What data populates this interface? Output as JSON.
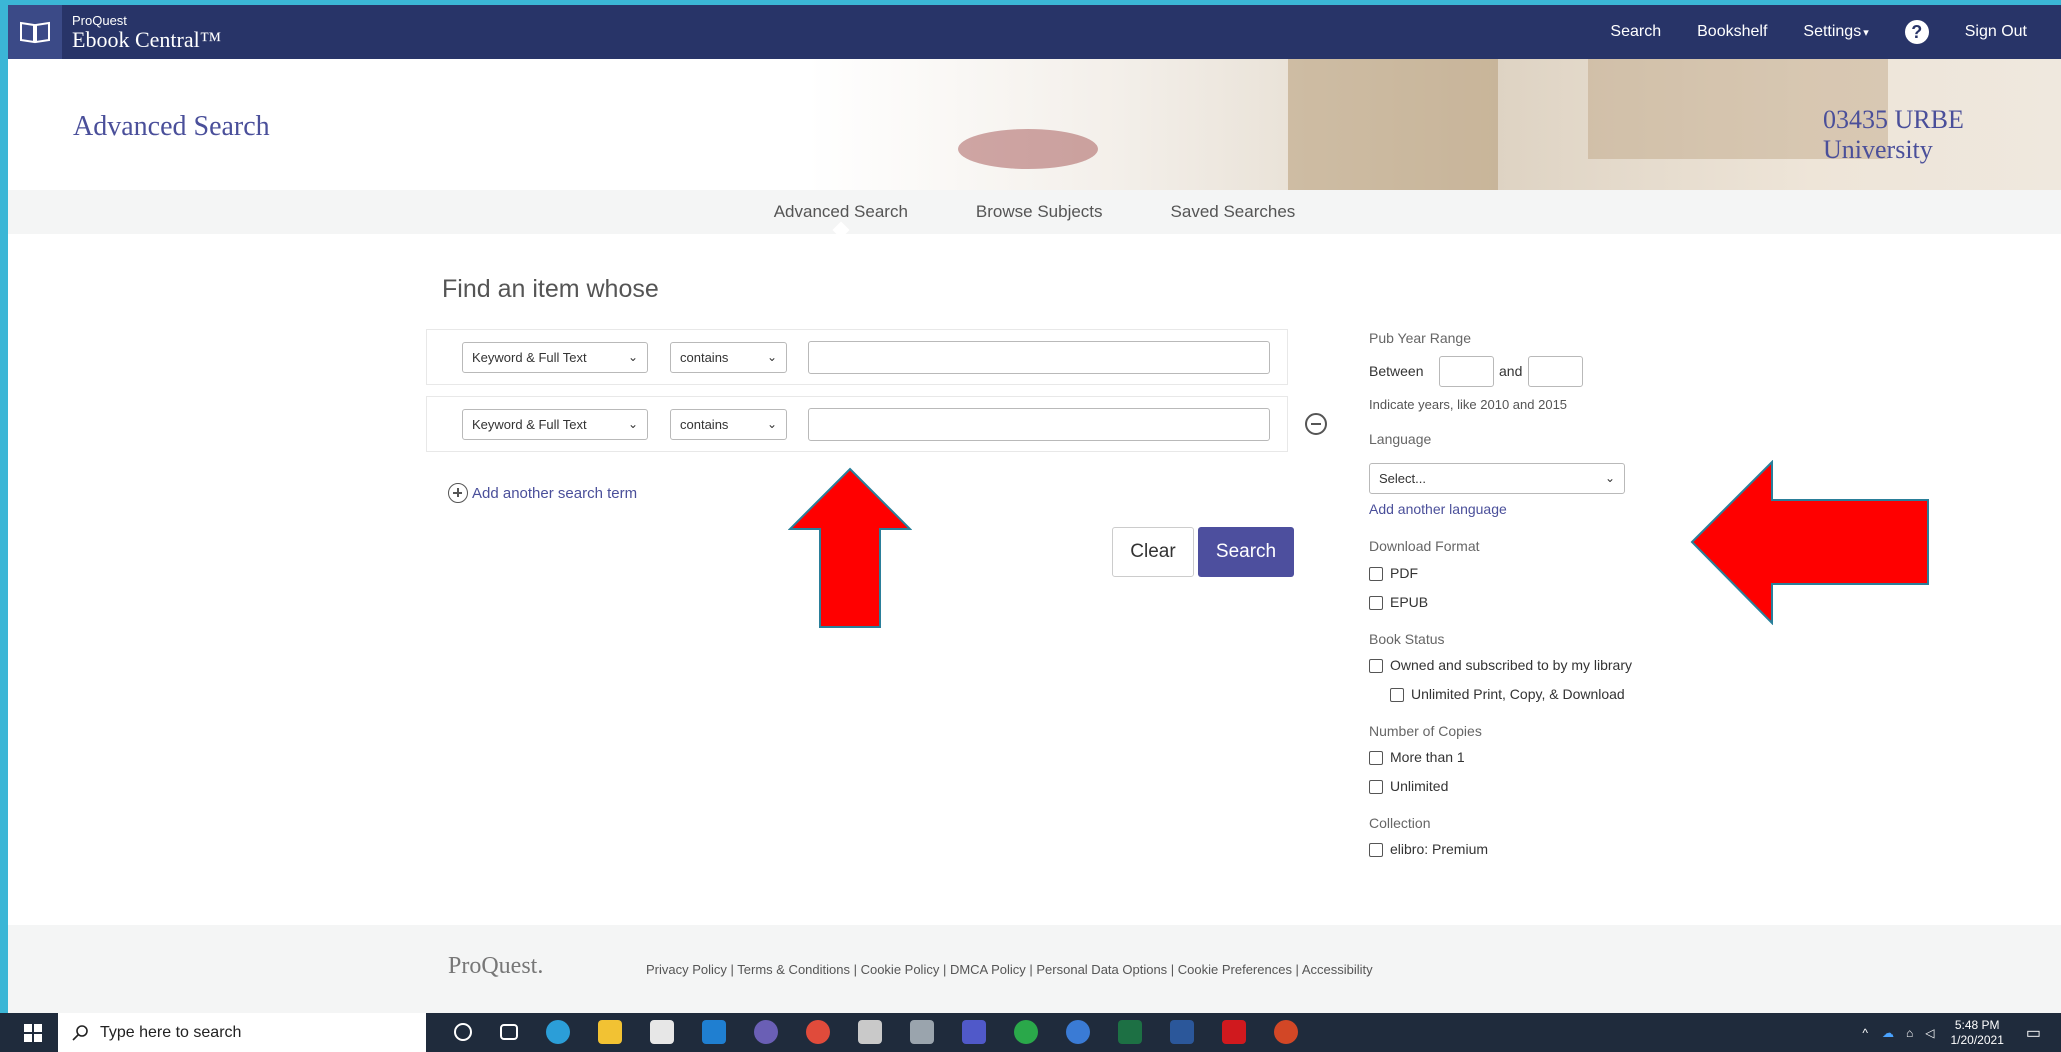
{
  "app": {
    "brand_small": "ProQuest",
    "brand_big": "Ebook Central™",
    "nav": {
      "search": "Search",
      "bookshelf": "Bookshelf",
      "settings": "Settings",
      "settings_caret": "▾",
      "help": "?",
      "signout": "Sign Out"
    }
  },
  "hero": {
    "title": "Advanced Search",
    "institution_line1": "03435 URBE",
    "institution_line2": "University"
  },
  "tabs": [
    "Advanced Search",
    "Browse Subjects",
    "Saved Searches"
  ],
  "form": {
    "title": "Find an item whose",
    "rows": [
      {
        "field": "Keyword & Full Text",
        "operator": "contains",
        "value": ""
      },
      {
        "field": "Keyword & Full Text",
        "operator": "contains",
        "value": ""
      }
    ],
    "add_term": "Add another search term",
    "clear": "Clear",
    "search": "Search"
  },
  "filters": {
    "pub_year_label": "Pub Year Range",
    "between": "Between",
    "and": "and",
    "hint": "Indicate years, like 2010 and 2015",
    "language_label": "Language",
    "language_value": "Select...",
    "add_language": "Add another language",
    "download_label": "Download Format",
    "download_options": [
      "PDF",
      "EPUB"
    ],
    "book_status_label": "Book Status",
    "book_status_options": [
      "Owned and subscribed to by my library",
      "Unlimited Print, Copy, & Download"
    ],
    "copies_label": "Number of Copies",
    "copies_options": [
      "More than 1",
      "Unlimited"
    ],
    "collection_label": "Collection",
    "collection_options": [
      "elibro: Premium"
    ]
  },
  "footer": {
    "logo": "ProQuest.",
    "links": "Privacy Policy | Terms & Conditions | Cookie Policy | DMCA Policy | Personal Data Options | Cookie Preferences | Accessibility"
  },
  "taskbar": {
    "search_placeholder": "Type here to search",
    "time": "5:48 PM",
    "date": "1/20/2021"
  },
  "colors": {
    "topbar": "#283468",
    "accent": "#4d4f9e",
    "annotation_arrow": "#ff0000",
    "desktop": "#3bb6d6"
  }
}
